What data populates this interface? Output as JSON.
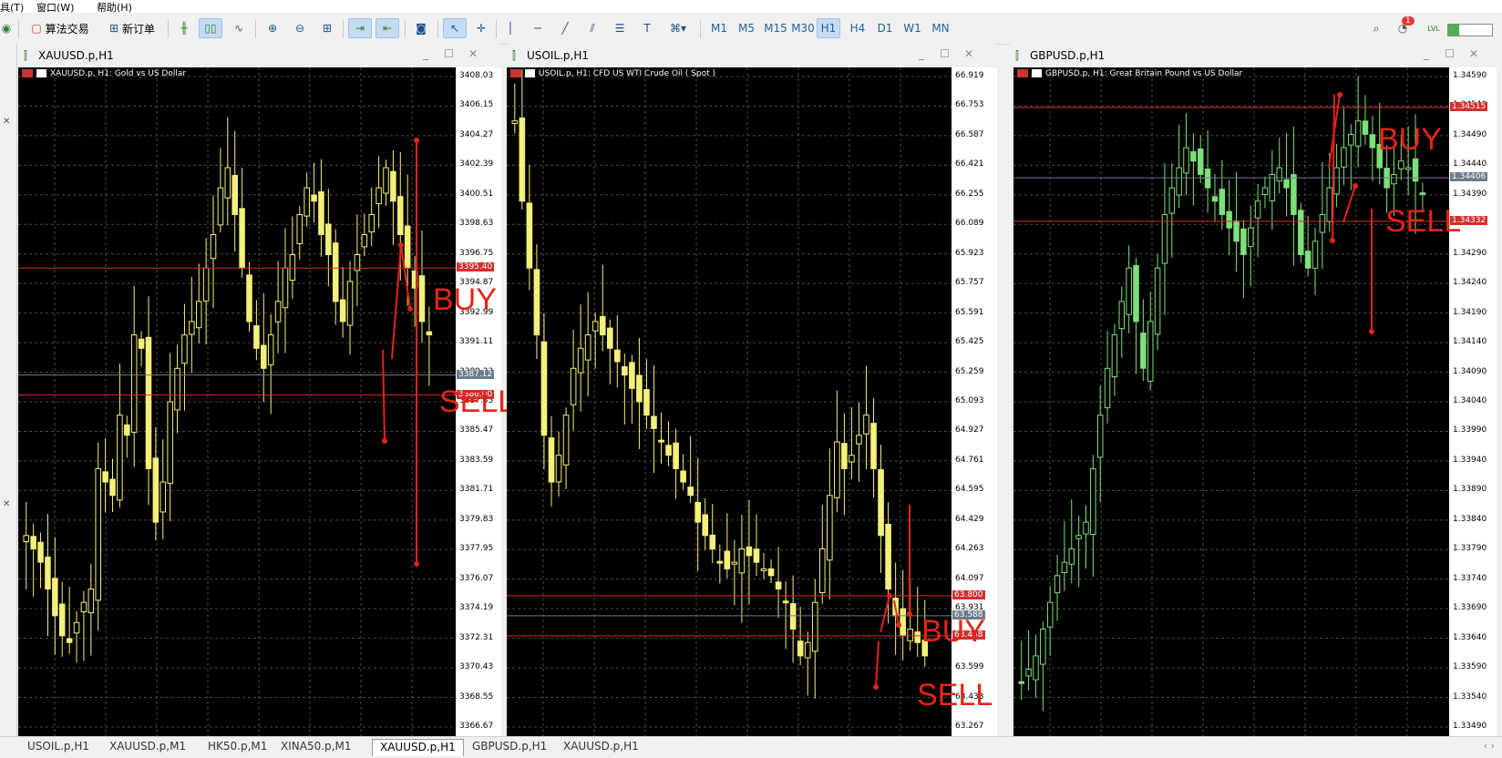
{
  "menu": {
    "item1": "具(T)",
    "item2": "窗口(W)",
    "item3": "帮助(H)"
  },
  "toolbar": {
    "algo_label": "算法交易",
    "new_order_label": "新订单",
    "timeframes": [
      "M1",
      "M5",
      "M15",
      "M30",
      "H1",
      "H4",
      "D1",
      "W1",
      "MN"
    ],
    "selected_timeframe": "H1",
    "notification_count": "1",
    "lvl_label": "LVL"
  },
  "charts": [
    {
      "title": "XAUUSD.p,H1",
      "header": "XAUUSD.p, H1:  Gold vs US Dollar",
      "yticks": [
        "3408.03",
        "3406.15",
        "3404.27",
        "3402.39",
        "3400.51",
        "3398.63",
        "3396.75",
        "3394.87",
        "3392.99",
        "3391.11",
        "3389.23",
        "3387.35",
        "3385.47",
        "3383.59",
        "3381.71",
        "3379.83",
        "3377.95",
        "3376.07",
        "3374.19",
        "3372.31",
        "3370.43",
        "3368.55",
        "3366.67"
      ],
      "price_tags": [
        {
          "label": "3395.40",
          "color": "#d32f2f"
        },
        {
          "label": "3387.12",
          "color": "#6d7b8a"
        },
        {
          "label": "3386.00",
          "color": "#d32f2f"
        }
      ],
      "annotations": [
        "BUY",
        "SELL"
      ],
      "candle_color": "#f5f07a"
    },
    {
      "title": "USOIL.p,H1",
      "header": "USOIL.p, H1:  CFD US WTI Crude Oil ( Spot )",
      "yticks": [
        "66.919",
        "66.753",
        "66.587",
        "66.421",
        "66.255",
        "66.089",
        "65.923",
        "65.757",
        "65.591",
        "65.425",
        "65.259",
        "65.093",
        "64.927",
        "64.761",
        "64.595",
        "64.429",
        "64.263",
        "64.097",
        "63.931",
        "63.765",
        "63.599",
        "63.433",
        "63.267"
      ],
      "price_tags": [
        {
          "label": "63.800",
          "color": "#d32f2f"
        },
        {
          "label": "63.588",
          "color": "#6d7b8a"
        },
        {
          "label": "63.458",
          "color": "#d32f2f"
        }
      ],
      "annotations": [
        "BUY",
        "SELL"
      ],
      "candle_color": "#f5f07a"
    },
    {
      "title": "GBPUSD.p,H1",
      "header": "GBPUSD.p, H1:  Great Britain Pound vs US Dollar",
      "yticks": [
        "1.34590",
        "1.34540",
        "1.34490",
        "1.34440",
        "1.34390",
        "1.34340",
        "1.34290",
        "1.34240",
        "1.34190",
        "1.34140",
        "1.34090",
        "1.34040",
        "1.33990",
        "1.33940",
        "1.33890",
        "1.33840",
        "1.33790",
        "1.33740",
        "1.33690",
        "1.33640",
        "1.33590",
        "1.33540",
        "1.33490"
      ],
      "price_tags": [
        {
          "label": "1.34515",
          "color": "#d32f2f"
        },
        {
          "label": "1.34406",
          "color": "#6d7b8a"
        },
        {
          "label": "1.34332",
          "color": "#d32f2f"
        }
      ],
      "annotations": [
        "BUY",
        "SELL"
      ],
      "candle_color": "#7ee07a"
    }
  ],
  "bottom_tabs": [
    "USOIL.p,H1",
    "XAUUSD.p,M1",
    "HK50.p,M1",
    "XINA50.p,M1",
    "XAUUSD.p,H1",
    "GBPUSD.p,H1",
    "XAUUSD.p,H1"
  ],
  "active_bottom_tab": "XAUUSD.p,H1"
}
